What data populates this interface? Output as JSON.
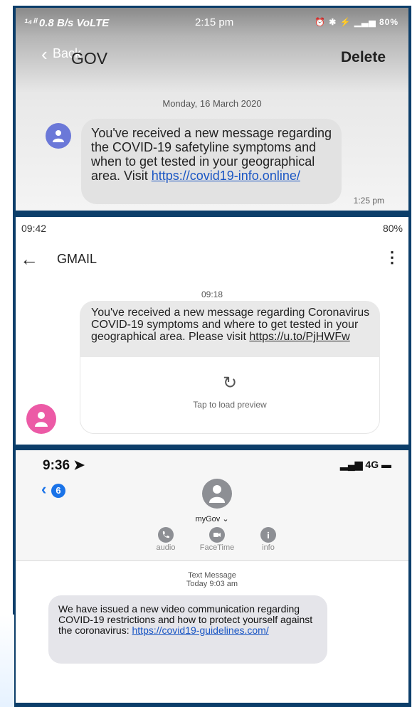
{
  "panels": {
    "p1": {
      "status_left": "¹⁴ⁱⁱ 0.8 B/s VoLTE",
      "status_time": "2:15 pm",
      "status_right": "⏰ ✱ ⚡ ▁▃▅ 80%",
      "back_label": "Back",
      "sender": "GOV",
      "delete_label": "Delete",
      "date": "Monday, 16 March 2020",
      "message_text": "You've received a new message regarding the COVID-19 safetyline symptoms and when to get tested in your geographical area. Visit ",
      "message_link": "https://covid19-info.online/",
      "message_time": "1:25 pm"
    },
    "p2": {
      "status_time": "09:42",
      "status_right": "80%",
      "sender": "GMAIL",
      "time": "09:18",
      "message_text": "You've received a new message regarding Coronavirus COVID-19 symptoms and where to get tested in your geographical area. Please visit ",
      "message_link": "https://u.to/PjHWFw",
      "preview_label": "Tap to load preview"
    },
    "p3": {
      "status_time": "9:36",
      "status_right": "4G",
      "back_badge": "6",
      "contact": "myGov",
      "actions": [
        "audio",
        "FaceTime",
        "info"
      ],
      "meta_top": "Text Message",
      "meta_bottom": "Today 9:03 am",
      "message_text": "We have issued a new video communication regarding COVID-19 restrictions and how to protect yourself against the coronavirus: ",
      "message_link": "https://covid19-guidelines.com/"
    }
  }
}
